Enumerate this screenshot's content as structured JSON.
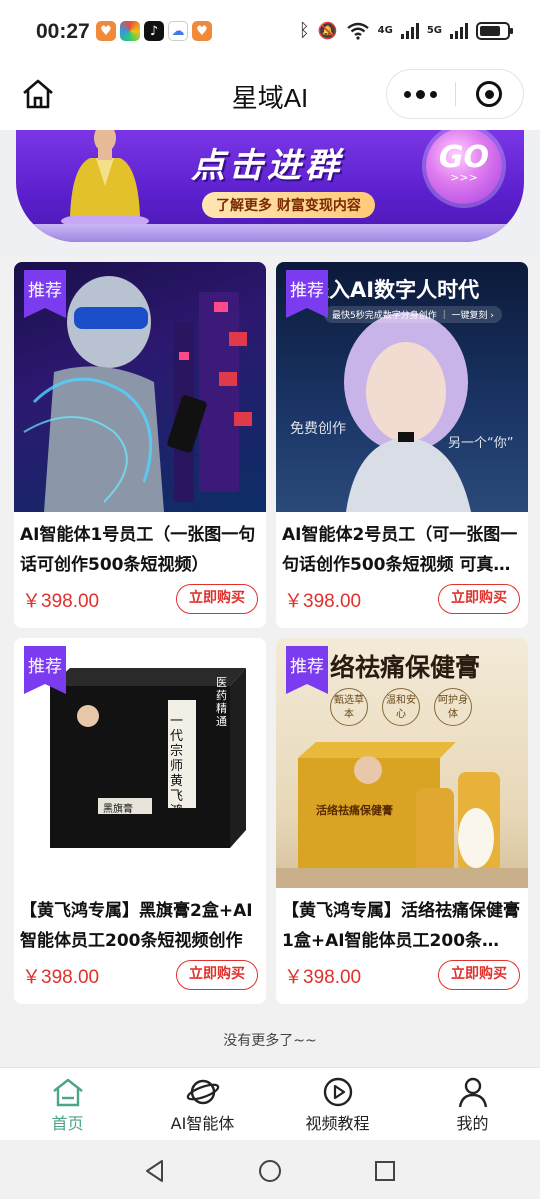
{
  "status_bar": {
    "time": "00:27",
    "network_4g": "4G",
    "network_5g": "5G"
  },
  "header": {
    "title": "星域AI"
  },
  "banner": {
    "title": "点击进群",
    "subtitle": "了解更多 财富变现内容",
    "go_text": "GO",
    "go_arrows": ">>>"
  },
  "products": [
    {
      "tag": "推荐",
      "name": "AI智能体1号员工（一张图一句话可创作500条短视频）",
      "price": "￥398.00",
      "buy_label": "立即购买"
    },
    {
      "tag": "推荐",
      "name": "AI智能体2号员工（可一张图一句话创作500条短视频 可真…",
      "price": "￥398.00",
      "buy_label": "立即购买",
      "thumb_headline": "进入AI数字人时代",
      "thumb_sub": "最快5秒完成数字分身创作 ｜ 一键复刻 ›",
      "thumb_left": "免费创作",
      "thumb_right": "另一个“你”"
    },
    {
      "tag": "推荐",
      "name": "【黄飞鸿专属】黑旗膏2盒+AI智能体员工200条短视频创作",
      "price": "￥398.00",
      "buy_label": "立即购买",
      "thumb_box_title": "一代宗师黄飞鸿",
      "thumb_box_side": "医药精通",
      "thumb_box_label": "黑旗膏"
    },
    {
      "tag": "推荐",
      "name": "【黄飞鸿专属】活络祛痛保健膏1盒+AI智能体员工200条…",
      "price": "￥398.00",
      "buy_label": "立即购买",
      "thumb_headline": "络祛痛保健膏",
      "thumb_badges": [
        "甄选草本",
        "温和安心",
        "呵护身体"
      ],
      "thumb_box_label": "活络祛痛保健膏"
    }
  ],
  "footer_note": "没有更多了~~",
  "tabs": [
    {
      "label": "首页",
      "icon": "home-icon",
      "active": true
    },
    {
      "label": "AI智能体",
      "icon": "planet-icon",
      "active": false
    },
    {
      "label": "视频教程",
      "icon": "play-circle-icon",
      "active": false
    },
    {
      "label": "我的",
      "icon": "person-icon",
      "active": false
    }
  ],
  "colors": {
    "accent_purple": "#7b3cf0",
    "price_red": "#e0312d",
    "tab_active": "#4ca48a"
  }
}
